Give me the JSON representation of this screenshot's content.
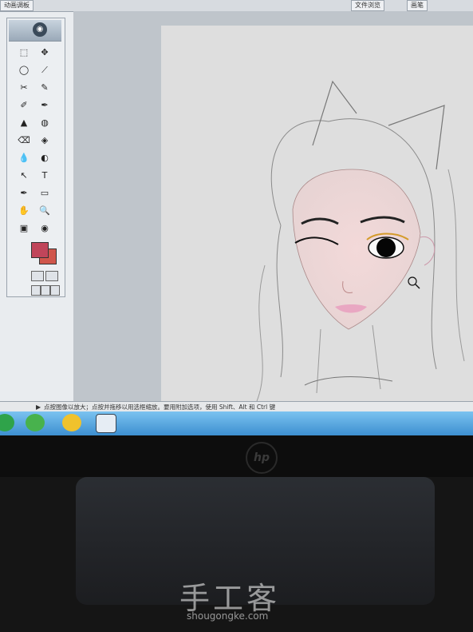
{
  "top_tabs": {
    "left_label": "动画调板",
    "right_label": "文件浏览",
    "right_label2": "画笔"
  },
  "toolbox": {
    "tools": [
      "⬚",
      "✥",
      "◯",
      "⟋",
      "✂",
      "✎",
      "✐",
      "✒",
      "▲",
      "◍",
      "⌫",
      "◈",
      "💧",
      "◐",
      "↖",
      "T",
      "✒",
      "▭",
      "✋",
      "🔍",
      "▣",
      "◉"
    ],
    "foreground_color": "#c0455a",
    "background_color": "#d0564c"
  },
  "status_bar": {
    "message": "点按图像以放大；点按并拖移以用选框缩放。要用附加选项，使用 Shift、Alt 和 Ctrl 键"
  },
  "taskbar": {
    "icons": [
      "ie-icon",
      "ie-icon-2",
      "qq-icon",
      "media-icon"
    ]
  },
  "monitor": {
    "brand": "hp"
  },
  "watermark": {
    "title": "手工客",
    "url": "shougongke.com"
  }
}
